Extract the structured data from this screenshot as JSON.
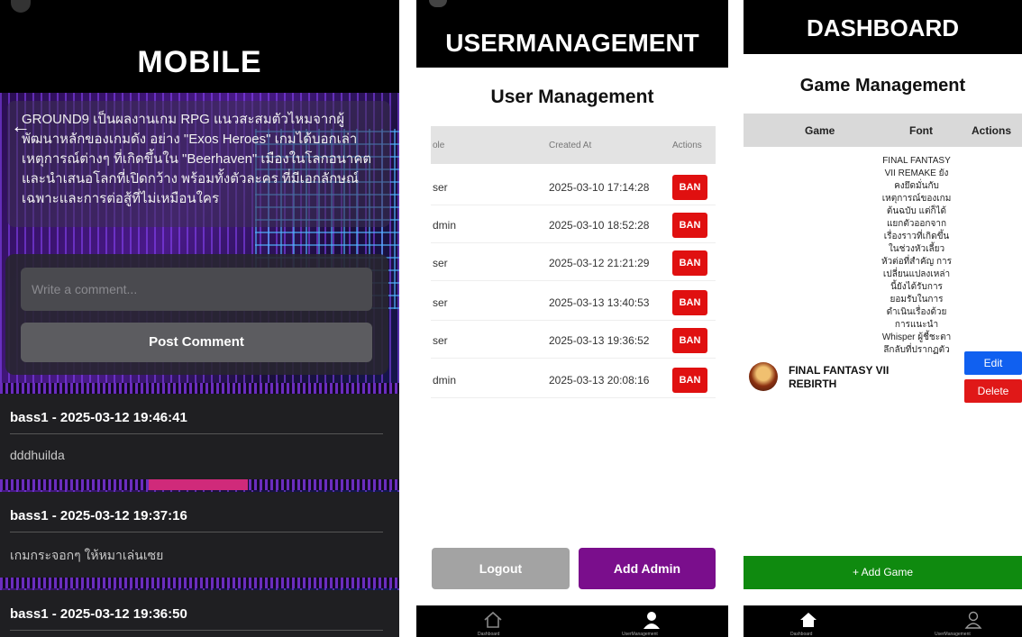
{
  "mobile": {
    "header_title": "MOBILE",
    "description": "GROUND9 เป็นผลงานเกม RPG แนวสะสมตัวไหมจากผู้พัฒนาหลักของเกมดัง อย่าง \"Exos Heroes\" เกมได้บอกเล่าเหตุการณ์ต่างๆ ที่เกิดขึ้นใน \"Beerhaven\" เมืองในโลกอนาคตและนำเสนอโลกที่เปิดกว้าง พร้อมทั้งตัวละคร ที่มีเอกลักษณ์เฉพาะและการต่อสู้ที่ไม่เหมือนใคร",
    "comment_placeholder": "Write a comment...",
    "post_button": "Post Comment",
    "comments": [
      {
        "author_time": "bass1 - 2025-03-12 19:46:41",
        "text": "dddhuilda"
      },
      {
        "author_time": "bass1 - 2025-03-12 19:37:16",
        "text": "เกมกระจอกๆ ให้หมาเล่นเซย"
      },
      {
        "author_time": "bass1 - 2025-03-12 19:36:50",
        "text": ""
      }
    ]
  },
  "users": {
    "header_title": "USERMANAGEMENT",
    "page_title": "User Management",
    "columns": [
      "ole",
      "Created At",
      "Actions"
    ],
    "rows": [
      {
        "role": "ser",
        "created": "2025-03-10 17:14:28",
        "action": "BAN"
      },
      {
        "role": "dmin",
        "created": "2025-03-10 18:52:28",
        "action": "BAN"
      },
      {
        "role": "ser",
        "created": "2025-03-12 21:21:29",
        "action": "BAN"
      },
      {
        "role": "ser",
        "created": "2025-03-13 13:40:53",
        "action": "BAN"
      },
      {
        "role": "ser",
        "created": "2025-03-13 19:36:52",
        "action": "BAN"
      },
      {
        "role": "dmin",
        "created": "2025-03-13 20:08:16",
        "action": "BAN"
      }
    ],
    "logout": "Logout",
    "add_admin": "Add Admin",
    "nav": {
      "dashboard": "Dashboard",
      "user_management": "UserManagement"
    }
  },
  "dashboard": {
    "header_title": "DASHBOARD",
    "page_title": "Game Management",
    "columns": [
      "Game",
      "Font",
      "Actions"
    ],
    "game": {
      "name": "FINAL FANTASY VII REBIRTH",
      "font": "FINAL FANTASY VII REMAKE ยังคงยึดมั่นกับเหตุการณ์ของเกมต้นฉบับ แต่ก็ได้แยกตัวออกจากเรื่องราวที่เกิดขึ้นในช่วงหัวเลี้ยวหัวต่อที่สำคัญ การเปลี่ยนแปลงเหล่านี้ยังได้รับการยอมรับในการดำเนินเรื่องด้วยการแนะนำ Whisper ผู้ชี้ชะตาลึกลับที่ปรากฏตัว"
    },
    "edit": "Edit",
    "delete": "Delete",
    "add_game": "+ Add Game",
    "nav": {
      "dashboard": "Dashboard",
      "user_management": "UserManagement"
    }
  }
}
